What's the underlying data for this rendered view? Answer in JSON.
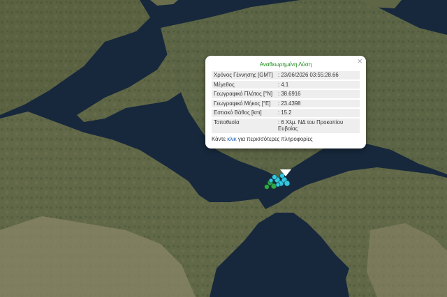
{
  "popup": {
    "title": "Αναθεωρημένη Λύση",
    "rows": [
      {
        "label": "Χρόνος Γέννησης [GMT]",
        "value": ": 23/06/2026 03:55:28.66"
      },
      {
        "label": "Μέγεθος",
        "value": ": 4.1"
      },
      {
        "label": "Γεωγραφικό Πλάτος [°N]",
        "value": ": 38.6916"
      },
      {
        "label": "Γεωγραφικό Μήκος [°E]",
        "value": ": 23.4398"
      },
      {
        "label": "Εστιακό Βάθος [km]",
        "value": ": 15.2"
      },
      {
        "label": "Τοποθεσία",
        "value": ": 6 Χλμ. ΝΔ του Προκοπίου Ευβοίας"
      }
    ],
    "footer_pre": "Κάντε ",
    "footer_link": "κλικ",
    "footer_post": " για περισσότερες πληροφορίες",
    "close": "×"
  },
  "map": {
    "colors": {
      "sea": "#17283c",
      "land": "#5a6242",
      "land_light": "#8a8a6a",
      "quake_cyan": "#33c8e0",
      "quake_green": "#2fa64a"
    }
  }
}
